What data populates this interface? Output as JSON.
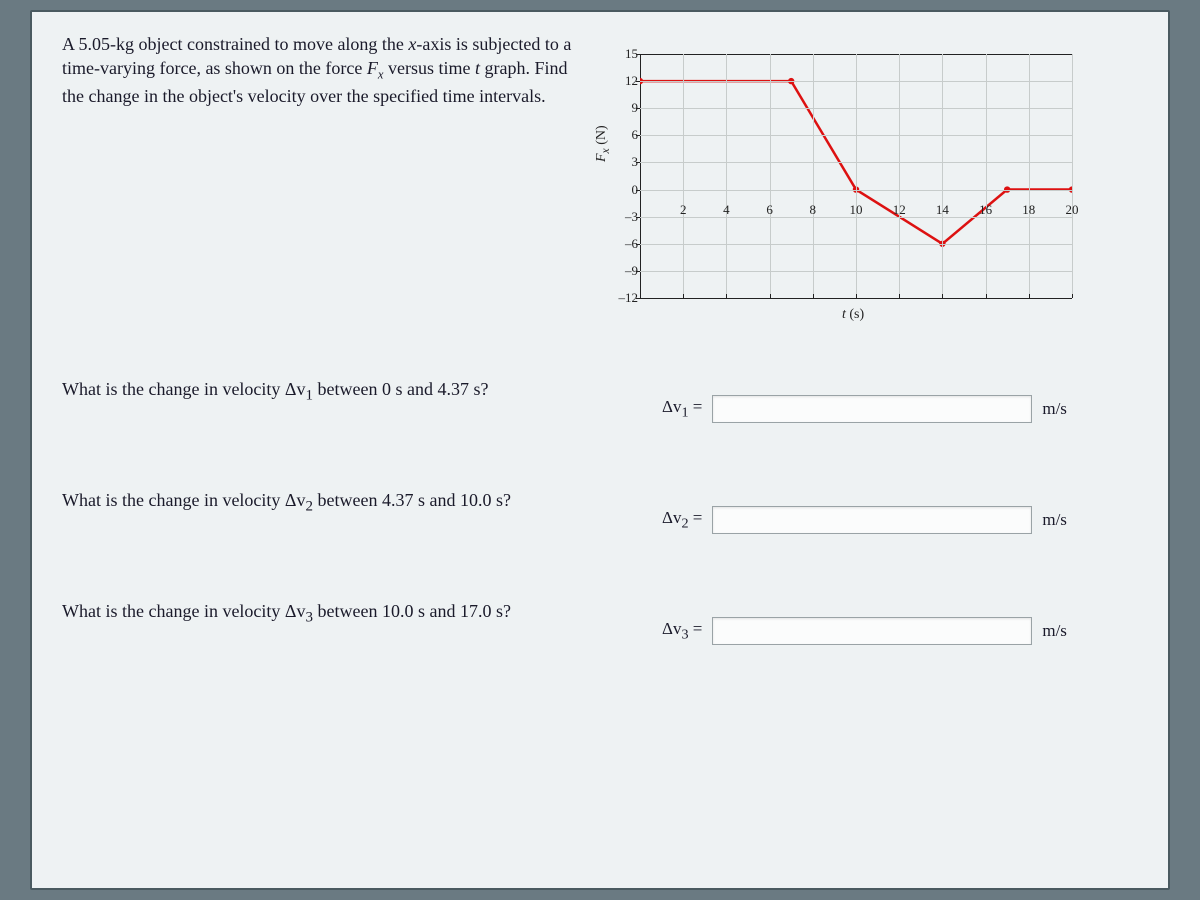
{
  "problem_text_html": "A 5.05-kg object constrained to move along the <span class='ital'>x</span>-axis is subjected to a time-varying force, as shown on the force <span class='ital'>F<sub>x</sub></span> versus time <span class='ital'>t</span> graph. Find the change in the object's velocity over the specified time intervals.",
  "chart_data": {
    "type": "line",
    "xlabel": "t (s)",
    "ylabel": "F_x (N)",
    "xlim": [
      0,
      20
    ],
    "ylim": [
      -12,
      15
    ],
    "xticks": [
      2,
      4,
      6,
      8,
      10,
      12,
      14,
      16,
      18,
      20
    ],
    "yticks": [
      15,
      12,
      9,
      6,
      3,
      0,
      -3,
      -6,
      -9,
      -12
    ],
    "points": [
      {
        "t": 0,
        "F": 12
      },
      {
        "t": 7,
        "F": 12
      },
      {
        "t": 10,
        "F": 0
      },
      {
        "t": 14,
        "F": -6
      },
      {
        "t": 17,
        "F": 0
      },
      {
        "t": 20,
        "F": 0
      }
    ]
  },
  "questions": [
    {
      "prompt_html": "What is the change in velocity Δ<span class='ital'>v</span><sub>1</sub> between 0 s and 4.37 s?",
      "label_html": "Δ<span class='ital'>v</span><sub>1</sub> =",
      "unit": "m/s"
    },
    {
      "prompt_html": "What is the change in velocity Δ<span class='ital'>v</span><sub>2</sub> between 4.37 s and 10.0 s?",
      "label_html": "Δ<span class='ital'>v</span><sub>2</sub> =",
      "unit": "m/s"
    },
    {
      "prompt_html": "What is the change in velocity Δ<span class='ital'>v</span><sub>3</sub> between 10.0 s and 17.0 s?",
      "label_html": "Δ<span class='ital'>v</span><sub>3</sub> =",
      "unit": "m/s"
    }
  ]
}
